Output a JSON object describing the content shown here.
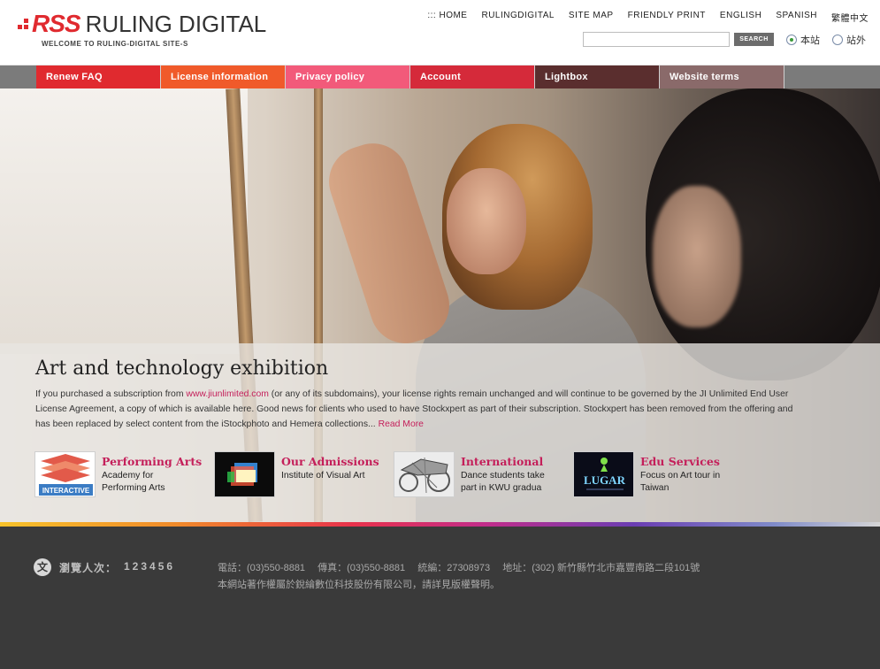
{
  "header": {
    "logo_rss": "RSS",
    "logo_name": "RULING DIGITAL",
    "tagline": "WELCOME TO RULING-DIGITAL SITE-S",
    "topnav": [
      ":::  HOME",
      "RULINGDIGITAL",
      "SITE MAP",
      "FRIENDLY PRINT",
      "ENGLISH",
      "SPANISH",
      "繁體中文"
    ],
    "search": {
      "placeholder": "",
      "button_label": "SEARCH"
    },
    "scope_options": [
      {
        "label": "本站",
        "selected": true
      },
      {
        "label": "站外",
        "selected": false
      }
    ]
  },
  "navbar": {
    "tabs": [
      {
        "label": "Renew FAQ",
        "color": "#e02a2f"
      },
      {
        "label": "License information",
        "color": "#f05a2a"
      },
      {
        "label": "Privacy policy",
        "color": "#f25a7a"
      },
      {
        "label": "Account",
        "color": "#d52a3a"
      },
      {
        "label": "Lightbox",
        "color": "#5a2e2e"
      },
      {
        "label": "Website terms",
        "color": "#8a6a6a"
      }
    ],
    "bar_color": "#7b7b7b"
  },
  "main": {
    "title": "Art and technology exhibition",
    "para_before_link": "If you purchased a subscription from ",
    "para_link": "www.jiunlimited.com",
    "para_after_link": " (or any of its subdomains), your license rights remain unchanged and will continue to be governed by the JI Unlimited End User License Agreement, a copy of which is available here. Good news for clients who used to have Stockxpert as part of their subscription. Stockxpert has been removed from the offering and has been replaced by select content from the iStockphoto and Hemera collections... ",
    "read_more": "Read More",
    "features": [
      {
        "title": "Performing Arts",
        "desc": "Academy for Performing Arts",
        "icon": "interactive-logo-icon",
        "thumb_text": "INTERACTIVE"
      },
      {
        "title": "Our Admissions",
        "desc": "Institute of Visual Art",
        "icon": "glowing-screen-icon"
      },
      {
        "title": "International",
        "desc": "Dance students take part in KWU gradua",
        "icon": "sketch-machine-icon"
      },
      {
        "title": "Edu Services",
        "desc": "Focus on Art tour in Taiwan",
        "icon": "lugar-logo-icon",
        "thumb_text": "LUGAR"
      }
    ]
  },
  "footer": {
    "visitor_label": "瀏覽人次：",
    "visitor_count": "123456",
    "line1": "電話：(03)550-8881　 傳真：(03)550-8881　 統編：27308973　 地址：(302) 新竹縣竹北市嘉豐南路二段101號",
    "line2": "本網站著作權屬於銳綸數位科技股份有限公司，請詳見版權聲明。"
  },
  "colors": {
    "accent": "#c41f5a",
    "brand_red": "#e02a2f",
    "footer_bg": "#3a3a3a"
  }
}
